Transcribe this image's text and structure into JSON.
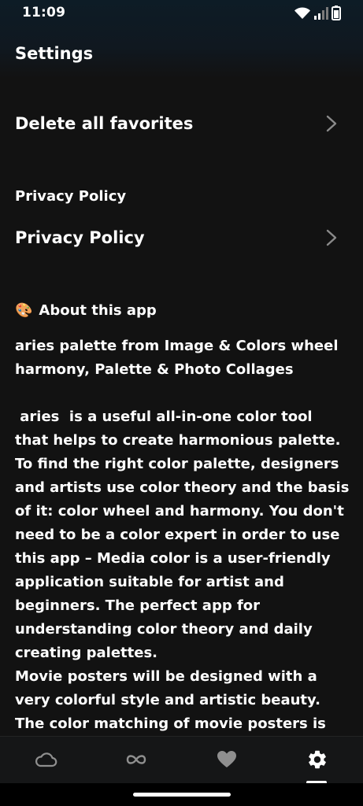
{
  "status_bar": {
    "time": "11:09",
    "icons": [
      "wifi-icon",
      "cellular-signal-icon",
      "battery-icon"
    ]
  },
  "header": {
    "title": "Settings"
  },
  "settings": {
    "delete_favorites_label": "Delete all favorites",
    "privacy_section_title": "Privacy Policy",
    "privacy_policy_label": "Privacy Policy"
  },
  "about": {
    "emoji": "🎨",
    "title": "About this app",
    "heading_text": "aries palette from Image & Colors wheel harmony, Palette & Photo Collages",
    "paragraph_1": " aries  is a useful all-in-one color tool that helps to create harmonious palette. To find the right color palette, designers and artists use color theory and the basis of it: color wheel and harmony. You don't need to be a color expert in order to use this app – Media color is a user-friendly application suitable for artist and beginners. The perfect app for understanding color theory and daily creating palettes.",
    "paragraph_2": "Movie posters will be designed with a very colorful style and artistic beauty. The color matching of movie posters is also an"
  },
  "bottom_nav": {
    "items": [
      "cloud-icon",
      "infinity-icon",
      "heart-icon",
      "gear-icon"
    ],
    "active_item": "gear-icon"
  },
  "colors": {
    "background": "#121212",
    "header_gradient_top": "#0d1c26",
    "text": "#ffffff",
    "chevron": "#8a8a8a",
    "nav_icon_inactive": "#8f8f8f",
    "nav_icon_active": "#ffffff"
  }
}
